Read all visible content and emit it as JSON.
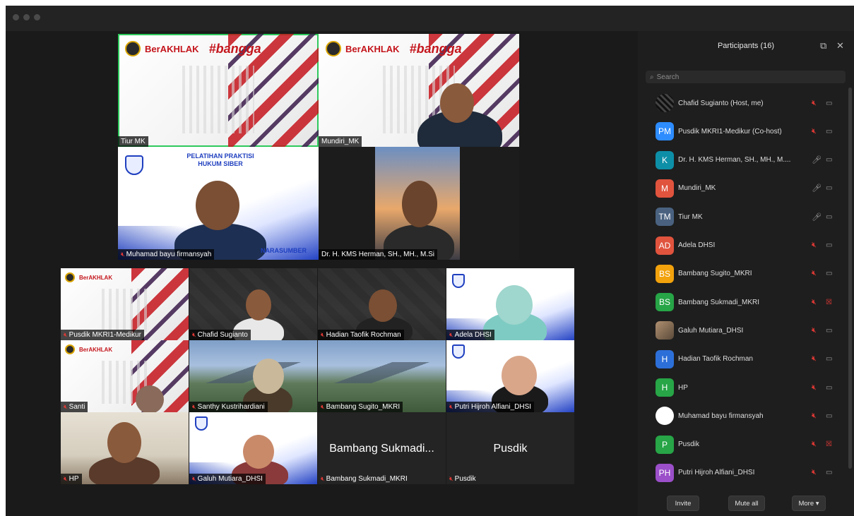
{
  "window": {
    "title": ""
  },
  "gallery": {
    "tiles": [
      {
        "name": "Tiur MK",
        "muted": false
      },
      {
        "name": "Mundiri_MK",
        "muted": false
      },
      {
        "name": "Muhamad bayu firmansyah",
        "muted": true,
        "slide_title": "PELATIHAN PRAKTISI\nHUKUM SIBER",
        "slide_footer": "NARASUMBER"
      },
      {
        "name": "Dr. H. KMS Herman, SH., MH., M.Si",
        "muted": false
      },
      {
        "name": "Pusdik MKRI1-Medikur",
        "muted": true
      },
      {
        "name": "Chafid Sugianto",
        "muted": true
      },
      {
        "name": "Hadian Taofik Rochman",
        "muted": true
      },
      {
        "name": "Adela DHSI",
        "muted": true
      },
      {
        "name": "Santi",
        "muted": true
      },
      {
        "name": "Santhy Kustrihardiani",
        "muted": true
      },
      {
        "name": "Bambang Sugito_MKRI",
        "muted": true
      },
      {
        "name": "Putri Hijroh Alfiani_DHSI",
        "muted": true
      },
      {
        "name": "HP",
        "muted": true
      },
      {
        "name": "Galuh Mutiara_DHSI",
        "muted": true
      },
      {
        "name": "Bambang Sukmadi_MKRI",
        "muted": true,
        "center_text": "Bambang Sukmadi..."
      },
      {
        "name": "Pusdik",
        "muted": true,
        "center_text": "Pusdik"
      }
    ],
    "branding": {
      "akhlak": "BerAKHLAK",
      "bangga": "#bangga"
    }
  },
  "participants": {
    "title": "Participants (16)",
    "search_placeholder": "Search",
    "list": [
      {
        "name": "Chafid Sugianto (Host, me)",
        "initials": "",
        "color": "#222222",
        "mic": "muted",
        "cam": "on"
      },
      {
        "name": "Pusdik MKRI1-Medikur (Co-host)",
        "initials": "PM",
        "color": "#2d8cff",
        "mic": "muted",
        "cam": "on"
      },
      {
        "name": "Dr. H. KMS Herman, SH., MH., M....",
        "initials": "K",
        "color": "#0e8fa8",
        "mic": "on",
        "cam": "on"
      },
      {
        "name": "Mundiri_MK",
        "initials": "M",
        "color": "#e0533d",
        "mic": "on",
        "cam": "on"
      },
      {
        "name": "Tiur MK",
        "initials": "TM",
        "color": "#4a6280",
        "mic": "on",
        "cam": "on"
      },
      {
        "name": "Adela DHSI",
        "initials": "AD",
        "color": "#e0533d",
        "mic": "muted",
        "cam": "on"
      },
      {
        "name": "Bambang Sugito_MKRI",
        "initials": "BS",
        "color": "#f2a20c",
        "mic": "muted",
        "cam": "on"
      },
      {
        "name": "Bambang Sukmadi_MKRI",
        "initials": "BS",
        "color": "#27a547",
        "mic": "muted",
        "cam": "off"
      },
      {
        "name": "Galuh Mutiara_DHSI",
        "initials": "",
        "color": "#7a6a5a",
        "mic": "muted",
        "cam": "on"
      },
      {
        "name": "Hadian Taofik Rochman",
        "initials": "H",
        "color": "#2d6fd8",
        "mic": "muted",
        "cam": "on"
      },
      {
        "name": "HP",
        "initials": "H",
        "color": "#27a547",
        "mic": "muted",
        "cam": "on"
      },
      {
        "name": "Muhamad bayu firmansyah",
        "initials": "",
        "color": "#ffffff",
        "mic": "muted",
        "cam": "on"
      },
      {
        "name": "Pusdik",
        "initials": "P",
        "color": "#27a547",
        "mic": "muted",
        "cam": "off"
      },
      {
        "name": "Putri Hijroh Alfiani_DHSI",
        "initials": "PH",
        "color": "#9b4fc9",
        "mic": "muted",
        "cam": "on"
      }
    ],
    "footer": {
      "invite": "Invite",
      "mute_all": "Mute all",
      "more": "More ▾"
    }
  },
  "colors": {
    "muted_red": "#e53935",
    "active_speaker": "#2ec95c"
  }
}
